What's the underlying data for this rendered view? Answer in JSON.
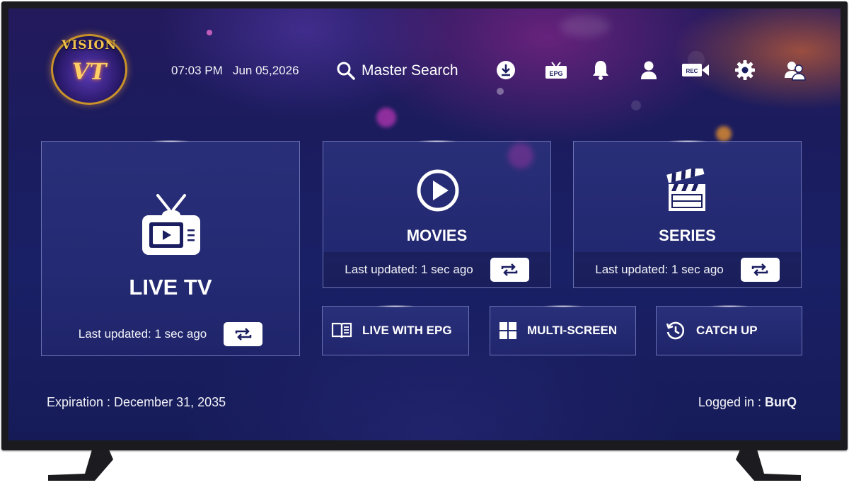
{
  "header": {
    "logo_word": "VISION",
    "logo_mono": "VT",
    "time": "07:03 PM",
    "date": "Jun 05,2026",
    "search_label": "Master Search",
    "icons": [
      "download-icon",
      "epg-icon",
      "bell-icon",
      "profile-icon",
      "rec-icon",
      "gear-icon",
      "switch-user-icon"
    ],
    "epg_text": "EPG",
    "rec_text": "REC"
  },
  "tiles": {
    "live_tv": {
      "label": "LIVE TV",
      "updated": "Last updated: 1 sec ago"
    },
    "movies": {
      "label": "MOVIES",
      "updated": "Last updated: 1 sec ago"
    },
    "series": {
      "label": "SERIES",
      "updated": "Last updated: 1 sec ago"
    }
  },
  "shortcuts": [
    {
      "label": "LIVE WITH EPG",
      "icon": "book-icon"
    },
    {
      "label": "MULTI-SCREEN",
      "icon": "grid-icon"
    },
    {
      "label": "CATCH UP",
      "icon": "history-icon"
    }
  ],
  "footer": {
    "expiration": "Expiration : December 31, 2035",
    "logged_in_label": "Logged in : ",
    "username": "BurQ"
  },
  "colors": {
    "background": "#1a1e60",
    "tile_border": "#bec8ff",
    "text": "#ffffff",
    "button_bg": "#ffffff",
    "logo_gold": "#f1c24e"
  }
}
